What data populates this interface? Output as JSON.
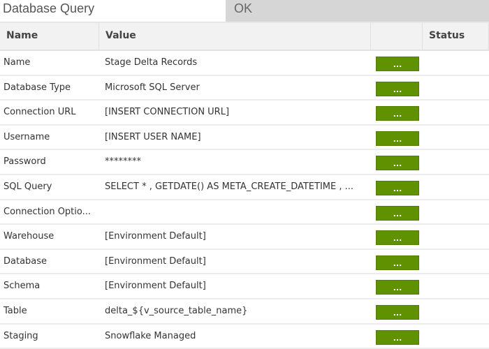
{
  "title": "Database Query",
  "ok_label": "OK",
  "headers": {
    "name": "Name",
    "value": "Value",
    "status": "Status"
  },
  "button_label": "...",
  "button_color": "#5f9100",
  "rows": [
    {
      "name": "Name",
      "value": "Stage Delta Records"
    },
    {
      "name": "Database Type",
      "value": "Microsoft SQL Server"
    },
    {
      "name": "Connection URL",
      "value": "[INSERT CONNECTION URL]"
    },
    {
      "name": "Username",
      "value": "[INSERT USER NAME]"
    },
    {
      "name": "Password",
      "value": "********"
    },
    {
      "name": "SQL Query",
      "value": "SELECT * , GETDATE() AS META_CREATE_DATETIME , ..."
    },
    {
      "name": "Connection Optio...",
      "value": ""
    },
    {
      "name": "Warehouse",
      "value": "[Environment Default]"
    },
    {
      "name": "Database",
      "value": "[Environment Default]"
    },
    {
      "name": "Schema",
      "value": "[Environment Default]"
    },
    {
      "name": "Table",
      "value": "delta_${v_source_table_name}"
    },
    {
      "name": "Staging",
      "value": "Snowflake Managed"
    }
  ]
}
